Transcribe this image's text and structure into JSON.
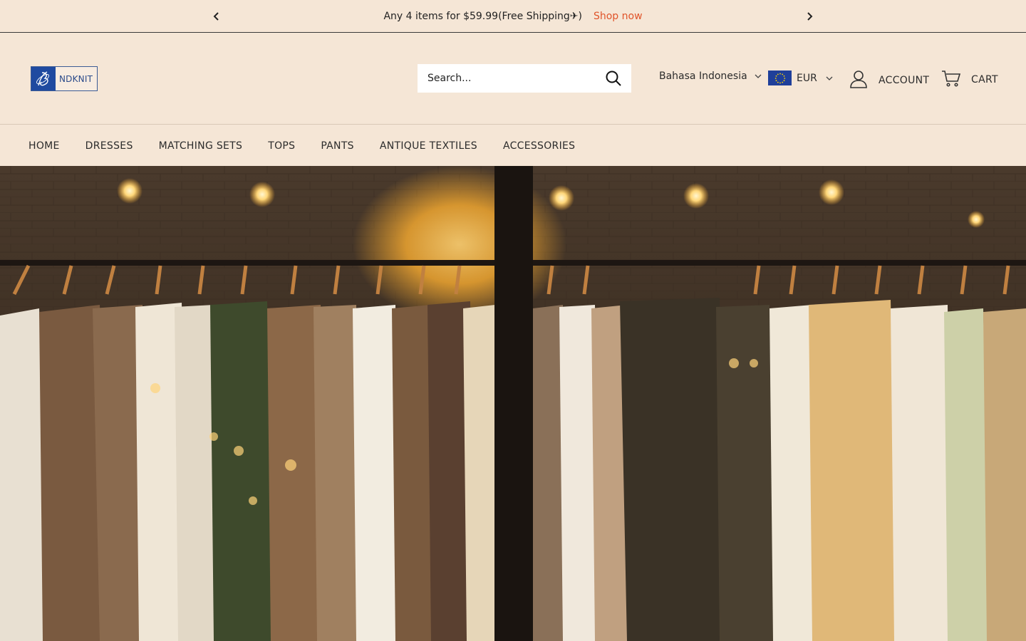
{
  "announcement": {
    "message": "Any 4 items for $59.99(Free Shipping✈)",
    "link": "Shop now",
    "prev_icon": "chevron-left-icon",
    "next_icon": "chevron-right-icon"
  },
  "brand": {
    "logo_text": "NDKNIT"
  },
  "search": {
    "placeholder": "Search...",
    "icon": "search-icon"
  },
  "language": {
    "selected": "Bahasa Indonesia"
  },
  "currency": {
    "selected": "EUR",
    "flag": "eu-flag-icon"
  },
  "account": {
    "label": "ACCOUNT",
    "icon": "user-icon"
  },
  "cart": {
    "label": "CART",
    "icon": "cart-icon"
  },
  "nav": {
    "items": [
      "HOME",
      "DRESSES",
      "MATCHING SETS",
      "TOPS",
      "PANTS",
      "ANTIQUE TEXTILES",
      "ACCESSORIES"
    ]
  },
  "colors": {
    "background": "#f5e6d6",
    "accent": "#e0542a",
    "brand_blue": "#1f4aa0"
  }
}
